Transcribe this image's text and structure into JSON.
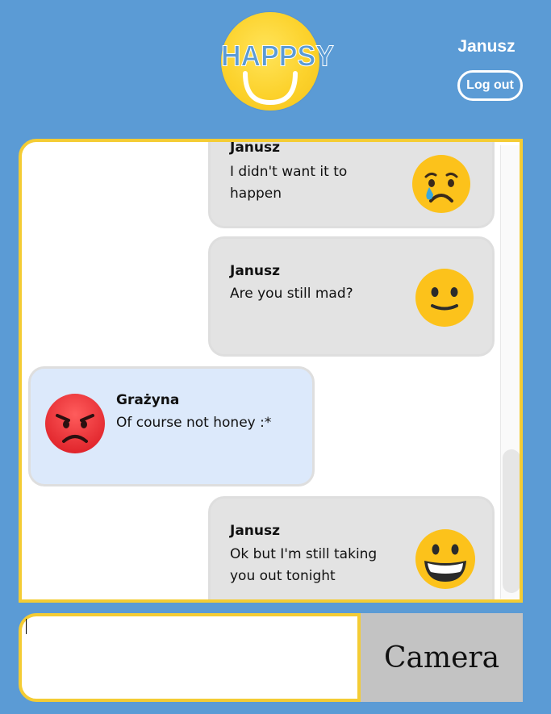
{
  "header": {
    "logo_text": "HAPPSY",
    "username": "Janusz",
    "logout_label": "Log out"
  },
  "messages": [
    {
      "sender": "Janusz",
      "text": "I didn't want it to happen",
      "emotion": "crying-face-icon",
      "side": "right"
    },
    {
      "sender": "Janusz",
      "text": "Are you still mad?",
      "emotion": "slightly-smiling-face-icon",
      "side": "right"
    },
    {
      "sender": "Grażyna",
      "text": "Of course not honey :*",
      "emotion": "angry-face-icon",
      "side": "left"
    },
    {
      "sender": "Janusz",
      "text": "Ok but I'm still taking you out tonight",
      "emotion": "grinning-face-icon",
      "side": "right"
    }
  ],
  "composer": {
    "input_value": "",
    "camera_label": "Camera"
  },
  "colors": {
    "background": "#5b9bd5",
    "accent_border": "#f4cc34",
    "own_bubble": "#e3e3e3",
    "other_bubble": "#dce9fb",
    "camera_button": "#c3c3c3"
  }
}
